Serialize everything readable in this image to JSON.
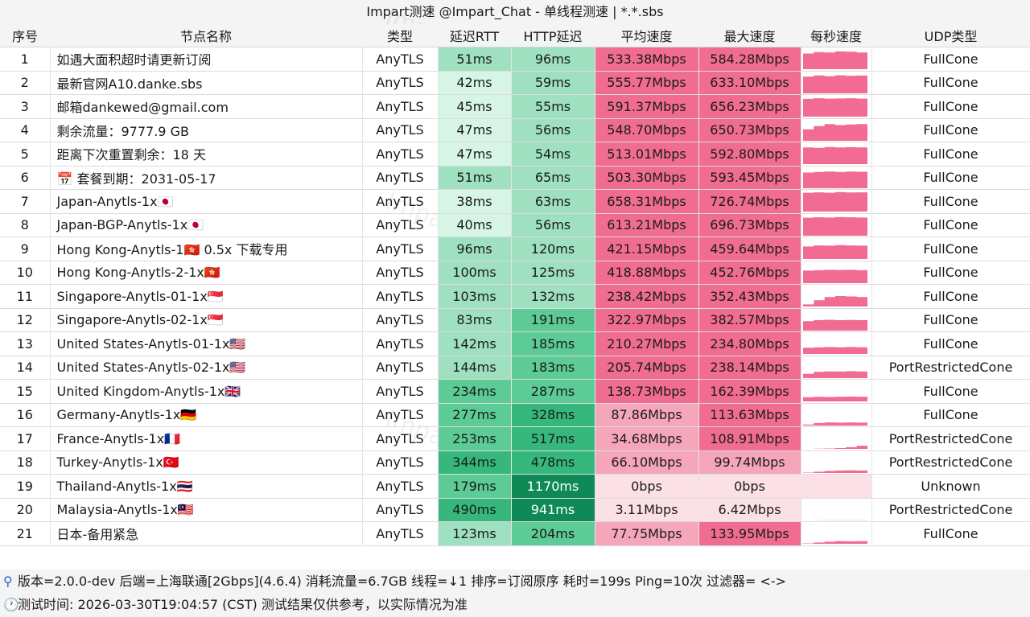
{
  "title": "Impart测速 @Impart_Chat - 单线程测速 | *.*.sbs",
  "watermark": "Impart测速 @Impart_Chat",
  "headers": [
    "序号",
    "节点名称",
    "类型",
    "延迟RTT",
    "HTTP延迟",
    "平均速度",
    "最大速度",
    "每秒速度",
    "UDP类型"
  ],
  "rows": [
    {
      "idx": "1",
      "name": "如遇大面积超时请更新订阅",
      "type": "AnyTLS",
      "rtt": "51ms",
      "http": "96ms",
      "avg": "533.38Mbps",
      "max": "584.28Mbps",
      "spark": [
        0.75,
        0.82,
        0.8,
        0.85,
        0.84,
        0.8
      ],
      "udp": "FullCone"
    },
    {
      "idx": "2",
      "name": "最新官网A10.danke.sbs",
      "type": "AnyTLS",
      "rtt": "42ms",
      "http": "59ms",
      "avg": "555.77Mbps",
      "max": "633.10Mbps",
      "spark": [
        0.8,
        0.85,
        0.82,
        0.86,
        0.84,
        0.85
      ],
      "udp": "FullCone"
    },
    {
      "idx": "3",
      "name": "邮箱dankewed@gmail.com",
      "type": "AnyTLS",
      "rtt": "45ms",
      "http": "55ms",
      "avg": "591.37Mbps",
      "max": "656.23Mbps",
      "spark": [
        0.85,
        0.88,
        0.86,
        0.87,
        0.88,
        0.86
      ],
      "udp": "FullCone"
    },
    {
      "idx": "4",
      "name": "剩余流量：9777.9 GB",
      "type": "AnyTLS",
      "rtt": "47ms",
      "http": "56ms",
      "avg": "548.70Mbps",
      "max": "650.73Mbps",
      "spark": [
        0.55,
        0.7,
        0.8,
        0.75,
        0.78,
        0.8
      ],
      "udp": "FullCone"
    },
    {
      "idx": "5",
      "name": "距离下次重置剩余：18 天",
      "type": "AnyTLS",
      "rtt": "47ms",
      "http": "54ms",
      "avg": "513.01Mbps",
      "max": "592.80Mbps",
      "spark": [
        0.8,
        0.78,
        0.82,
        0.8,
        0.81,
        0.8
      ],
      "udp": "FullCone"
    },
    {
      "idx": "6",
      "name": "📅 套餐到期：2031-05-17",
      "type": "AnyTLS",
      "rtt": "51ms",
      "http": "65ms",
      "avg": "503.30Mbps",
      "max": "593.45Mbps",
      "spark": [
        0.75,
        0.78,
        0.8,
        0.78,
        0.8,
        0.79
      ],
      "udp": "FullCone"
    },
    {
      "idx": "7",
      "name": "Japan-Anytls-1x🇯🇵",
      "type": "AnyTLS",
      "rtt": "38ms",
      "http": "63ms",
      "avg": "658.31Mbps",
      "max": "726.74Mbps",
      "spark": [
        0.9,
        0.92,
        0.9,
        0.93,
        0.91,
        0.92
      ],
      "udp": "FullCone"
    },
    {
      "idx": "8",
      "name": "Japan-BGP-Anytls-1x🇯🇵",
      "type": "AnyTLS",
      "rtt": "40ms",
      "http": "56ms",
      "avg": "613.21Mbps",
      "max": "696.73Mbps",
      "spark": [
        0.86,
        0.88,
        0.87,
        0.89,
        0.88,
        0.87
      ],
      "udp": "FullCone"
    },
    {
      "idx": "9",
      "name": "Hong Kong-Anytls-1🇭🇰 0.5x 下载专用",
      "type": "AnyTLS",
      "rtt": "96ms",
      "http": "120ms",
      "avg": "421.15Mbps",
      "max": "459.64Mbps",
      "spark": [
        0.6,
        0.65,
        0.64,
        0.66,
        0.65,
        0.64
      ],
      "udp": "FullCone"
    },
    {
      "idx": "10",
      "name": "Hong Kong-Anytls-2-1x🇭🇰",
      "type": "AnyTLS",
      "rtt": "100ms",
      "http": "125ms",
      "avg": "418.88Mbps",
      "max": "452.76Mbps",
      "spark": [
        0.6,
        0.62,
        0.64,
        0.63,
        0.64,
        0.62
      ],
      "udp": "FullCone"
    },
    {
      "idx": "11",
      "name": "Singapore-Anytls-01-1x🇸🇬",
      "type": "AnyTLS",
      "rtt": "103ms",
      "http": "132ms",
      "avg": "238.42Mbps",
      "max": "352.43Mbps",
      "spark": [
        0.1,
        0.3,
        0.45,
        0.5,
        0.48,
        0.45
      ],
      "udp": "FullCone"
    },
    {
      "idx": "12",
      "name": "Singapore-Anytls-02-1x🇸🇬",
      "type": "AnyTLS",
      "rtt": "83ms",
      "http": "191ms",
      "avg": "322.97Mbps",
      "max": "382.57Mbps",
      "spark": [
        0.45,
        0.5,
        0.52,
        0.5,
        0.51,
        0.5
      ],
      "udp": "FullCone"
    },
    {
      "idx": "13",
      "name": "United States-Anytls-01-1x🇺🇸",
      "type": "AnyTLS",
      "rtt": "142ms",
      "http": "185ms",
      "avg": "210.27Mbps",
      "max": "234.80Mbps",
      "spark": [
        0.3,
        0.32,
        0.33,
        0.32,
        0.33,
        0.32
      ],
      "udp": "FullCone"
    },
    {
      "idx": "14",
      "name": "United States-Anytls-02-1x🇺🇸",
      "type": "AnyTLS",
      "rtt": "144ms",
      "http": "183ms",
      "avg": "205.74Mbps",
      "max": "238.14Mbps",
      "spark": [
        0.2,
        0.3,
        0.32,
        0.31,
        0.33,
        0.32
      ],
      "udp": "PortRestrictedCone"
    },
    {
      "idx": "15",
      "name": "United Kingdom-Anytls-1x🇬🇧",
      "type": "AnyTLS",
      "rtt": "234ms",
      "http": "287ms",
      "avg": "138.73Mbps",
      "max": "162.39Mbps",
      "spark": [
        0.2,
        0.22,
        0.21,
        0.22,
        0.23,
        0.22
      ],
      "udp": "FullCone"
    },
    {
      "idx": "16",
      "name": "Germany-Anytls-1x🇩🇪",
      "type": "AnyTLS",
      "rtt": "277ms",
      "http": "328ms",
      "avg": "87.86Mbps",
      "max": "113.63Mbps",
      "spark": [
        0.05,
        0.12,
        0.15,
        0.14,
        0.15,
        0.14
      ],
      "udp": "FullCone"
    },
    {
      "idx": "17",
      "name": "France-Anytls-1x🇫🇷",
      "type": "AnyTLS",
      "rtt": "253ms",
      "http": "517ms",
      "avg": "34.68Mbps",
      "max": "108.91Mbps",
      "spark": [
        0.0,
        0.01,
        0.02,
        0.04,
        0.08,
        0.15
      ],
      "udp": "PortRestrictedCone"
    },
    {
      "idx": "18",
      "name": "Turkey-Anytls-1x🇹🇷",
      "type": "AnyTLS",
      "rtt": "344ms",
      "http": "478ms",
      "avg": "66.10Mbps",
      "max": "99.74Mbps",
      "spark": [
        0.02,
        0.06,
        0.1,
        0.12,
        0.13,
        0.12
      ],
      "udp": "PortRestrictedCone"
    },
    {
      "idx": "19",
      "name": "Thailand-Anytls-1x🇹🇭",
      "type": "AnyTLS",
      "rtt": "179ms",
      "http": "1170ms",
      "avg": "0bps",
      "max": "0bps",
      "spark": [
        0,
        0,
        0,
        0,
        0,
        0
      ],
      "udp": "Unknown"
    },
    {
      "idx": "20",
      "name": "Malaysia-Anytls-1x🇲🇾",
      "type": "AnyTLS",
      "rtt": "490ms",
      "http": "941ms",
      "avg": "3.11Mbps",
      "max": "6.42Mbps",
      "spark": [
        0,
        0.005,
        0.01,
        0.008,
        0.01,
        0.009
      ],
      "udp": "PortRestrictedCone"
    },
    {
      "idx": "21",
      "name": "日本-备用紧急",
      "type": "AnyTLS",
      "rtt": "123ms",
      "http": "204ms",
      "avg": "77.75Mbps",
      "max": "133.95Mbps",
      "spark": [
        0.02,
        0.06,
        0.1,
        0.13,
        0.12,
        0.13
      ],
      "udp": "FullCone"
    }
  ],
  "footer": {
    "line1": "版本=2.0.0-dev  后端=上海联通[2Gbps](4.6.4) 消耗流量=6.7GB  线程=↓1  排序=订阅原序  耗时=199s  Ping=10次  过滤器= <->",
    "line2": "测试时间: 2026-03-30T19:04:57 (CST)  测试结果仅供参考，以实际情况为准"
  },
  "colors": {
    "latency_scale": [
      "#d6f5e6",
      "#9ee0bf",
      "#5ccb95",
      "#36b87d",
      "#0f8a57"
    ],
    "speed_high": "#f06d91",
    "speed_mid": "#f5a6bb",
    "speed_low": "#fbe0e6",
    "spark_fill": "#f26b92"
  }
}
